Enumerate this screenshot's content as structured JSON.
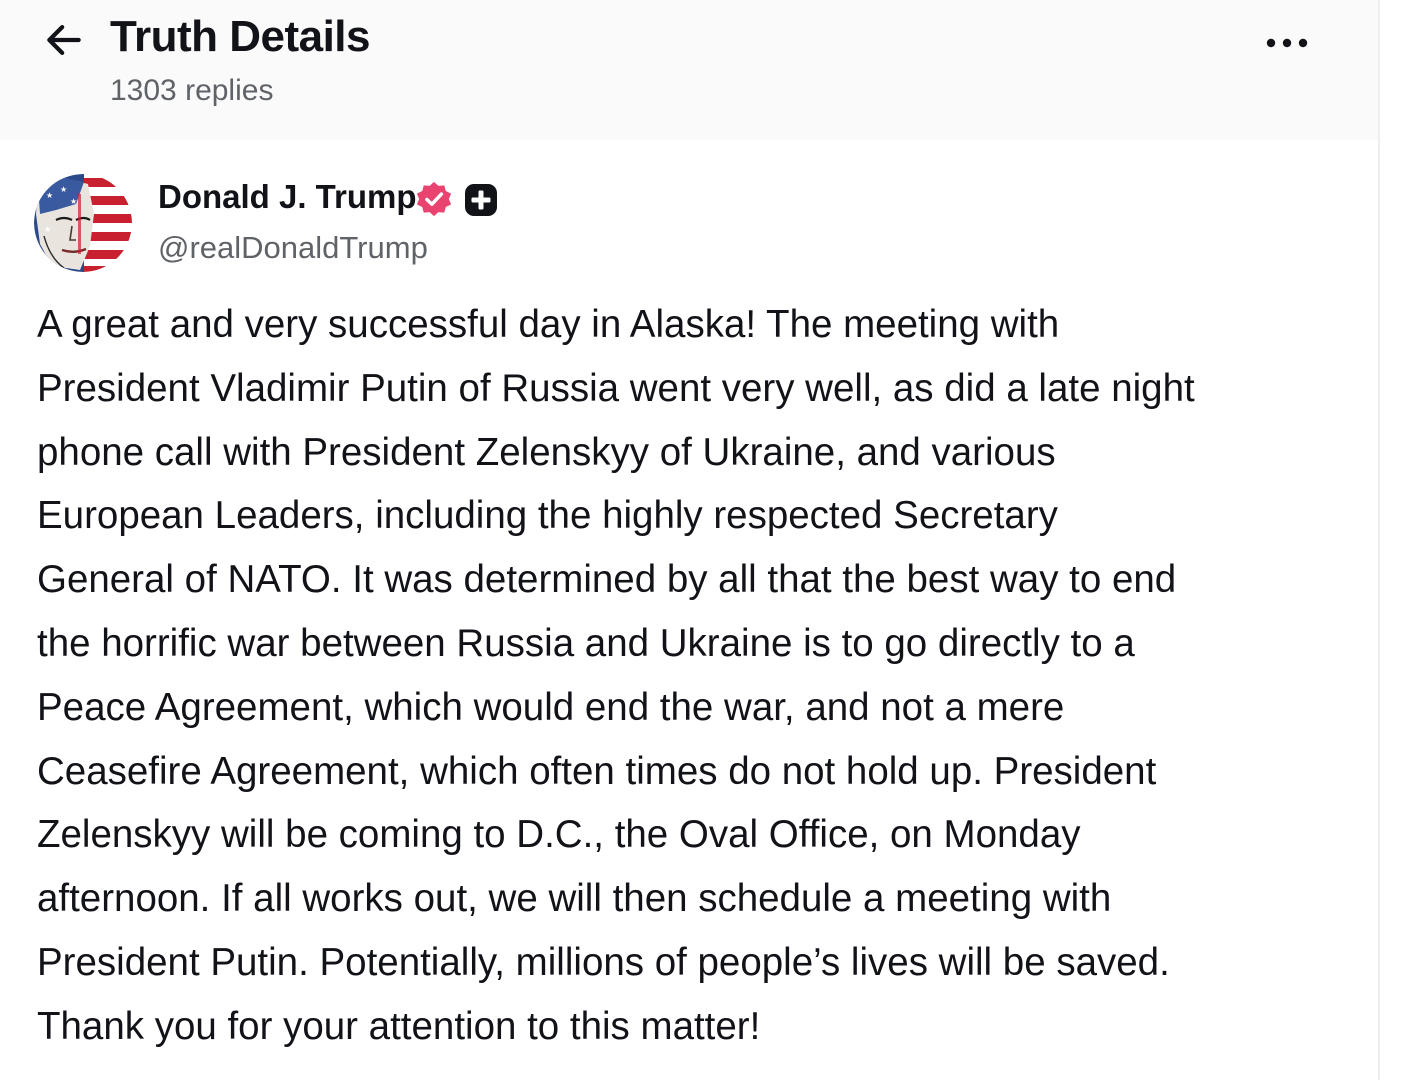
{
  "header": {
    "title": "Truth Details",
    "replies": "1303 replies"
  },
  "post": {
    "author": {
      "name": "Donald J. Trump",
      "handle": "@realDonaldTrump"
    },
    "text_lines": [
      "A great and very successful day in Alaska! The meeting with",
      "President Vladimir Putin of Russia went very well, as did a late night",
      "phone call with President Zelenskyy of Ukraine, and various",
      "European Leaders, including the highly respected Secretary",
      "General of NATO. It was determined by all that the best way to end",
      "the horrific war between Russia and Ukraine is to go directly to a",
      "Peace Agreement, which would end the war, and not a mere",
      "Ceasefire Agreement, which often times do not hold up. President",
      "Zelenskyy will be coming to D.C., the Oval Office, on Monday",
      "afternoon. If all works out, we will then schedule a meeting with",
      "President Putin. Potentially, millions of people’s lives will be saved.",
      "Thank you for your attention to this matter!"
    ]
  },
  "icons": {
    "back": "arrow-left-icon",
    "more": "more-horizontal-icon",
    "verified": "verified-badge-icon",
    "plus": "truth-plus-badge-icon"
  },
  "colors": {
    "text_primary": "#111318",
    "text_secondary": "#5f6368",
    "header_bg": "#fafafb",
    "verified": "#e8446f",
    "plus_badge": "#111318"
  }
}
